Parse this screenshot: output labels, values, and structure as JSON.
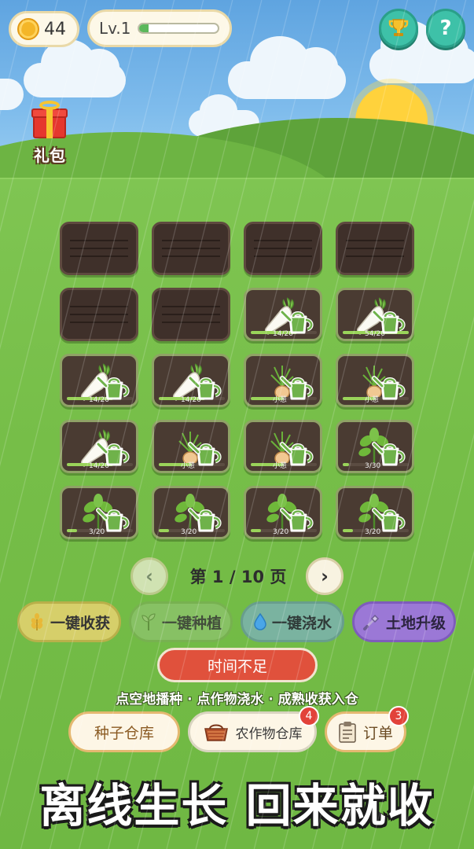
{
  "top_bar": {
    "coins": "44",
    "level_label": "Lv.1",
    "level_progress": 0.12,
    "trophy_icon": "trophy-icon",
    "help_label": "?"
  },
  "gift": {
    "label": "礼包",
    "icon": "gift-box-icon"
  },
  "plots": [
    {
      "state": "empty"
    },
    {
      "state": "empty"
    },
    {
      "state": "empty"
    },
    {
      "state": "empty"
    },
    {
      "state": "empty"
    },
    {
      "state": "empty"
    },
    {
      "state": "growing",
      "crop": "radish",
      "progress": "14/20",
      "fill": 0.7
    },
    {
      "state": "growing",
      "crop": "radish",
      "progress": "54/20",
      "fill": 1.0
    },
    {
      "state": "growing",
      "crop": "radish",
      "progress": "14/20",
      "fill": 0.7
    },
    {
      "state": "growing",
      "crop": "radish",
      "progress": "14/20",
      "fill": 0.7
    },
    {
      "state": "growing",
      "crop": "onion",
      "progress": "小葱",
      "fill": 0.5
    },
    {
      "state": "growing",
      "crop": "onion",
      "progress": "小葱",
      "fill": 0.5
    },
    {
      "state": "growing",
      "crop": "radish",
      "progress": "14/20",
      "fill": 0.7
    },
    {
      "state": "growing",
      "crop": "onion",
      "progress": "小葱",
      "fill": 0.5
    },
    {
      "state": "growing",
      "crop": "onion",
      "progress": "小葱",
      "fill": 0.5
    },
    {
      "state": "growing",
      "crop": "sprout",
      "progress": "3/30",
      "fill": 0.1
    },
    {
      "state": "growing",
      "crop": "sprout",
      "progress": "3/20",
      "fill": 0.15
    },
    {
      "state": "growing",
      "crop": "sprout",
      "progress": "3/20",
      "fill": 0.15
    },
    {
      "state": "growing",
      "crop": "sprout",
      "progress": "3/20",
      "fill": 0.15
    },
    {
      "state": "growing",
      "crop": "sprout",
      "progress": "3/20",
      "fill": 0.15
    }
  ],
  "pager": {
    "prev": "‹",
    "next": "›",
    "text": "第 1 / 10 页"
  },
  "actions": {
    "harvest": "一键收获",
    "plant": "一键种植",
    "water": "一键浇水",
    "upgrade": "土地升级"
  },
  "notice": "时间不足",
  "hint": "点空地播种 · 点作物浇水 · 成熟收获入仓",
  "bottom": {
    "seed_store": "种子仓库",
    "crop_store": "农作物仓库",
    "crop_store_badge": "4",
    "order": "订单",
    "order_badge": "3"
  },
  "tagline": "离线生长 回来就收",
  "colors": {
    "sky": "#7fbcec",
    "grass": "#76be48",
    "soil": "#4a3b32",
    "notice_red": "#e0513c",
    "teal_button": "#3ec1a8"
  }
}
